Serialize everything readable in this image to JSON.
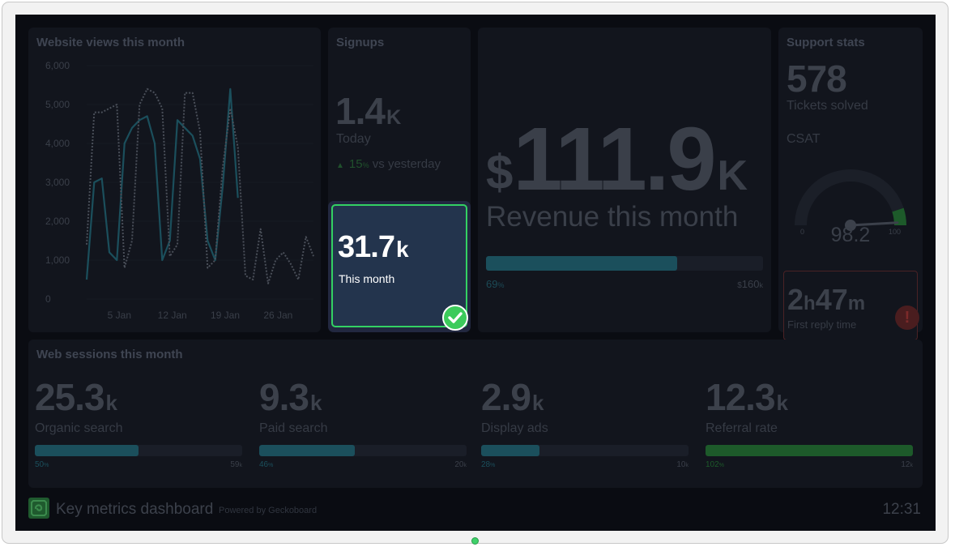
{
  "views_widget": {
    "title": "Website views this month",
    "chart_data": {
      "type": "line",
      "yticks": [
        "6,000",
        "5,000",
        "4,000",
        "3,000",
        "2,000",
        "1,000",
        "0"
      ],
      "xticks": [
        "5 Jan",
        "12 Jan",
        "19 Jan",
        "26 Jan"
      ],
      "ylim": [
        0,
        6000
      ],
      "series": [
        {
          "style": "solid",
          "color": "#1b4f5c",
          "x": [
            1,
            2,
            3,
            4,
            5,
            6,
            7,
            8,
            9,
            10,
            11,
            12,
            13,
            14,
            15,
            16,
            17,
            18,
            19,
            20,
            21
          ],
          "values": [
            500,
            3000,
            3100,
            1200,
            1000,
            4000,
            4400,
            4600,
            4700,
            4000,
            1000,
            1500,
            4600,
            4400,
            4200,
            3600,
            1500,
            1000,
            2900,
            5400,
            2600
          ]
        },
        {
          "style": "dotted",
          "color": "#4a4f59",
          "x": [
            1,
            2,
            3,
            4,
            5,
            6,
            7,
            8,
            9,
            10,
            11,
            12,
            13,
            14,
            15,
            16,
            17,
            18,
            19,
            20,
            21,
            22,
            23,
            24,
            25,
            26,
            27,
            28,
            29,
            30,
            31
          ],
          "values": [
            1400,
            4800,
            4800,
            4900,
            5000,
            800,
            1500,
            5000,
            5400,
            5300,
            4900,
            1100,
            1400,
            5300,
            5300,
            4300,
            800,
            1000,
            3400,
            4900,
            3900,
            600,
            500,
            1800,
            400,
            1000,
            1200,
            900,
            500,
            1600,
            1100
          ]
        }
      ]
    }
  },
  "signups_widget": {
    "title": "Signups",
    "today_value": "1.4",
    "today_unit": "K",
    "today_label": "Today",
    "change_value": "15",
    "change_unit": "%",
    "change_label": "vs yesterday",
    "month_value": "31.7",
    "month_unit": "k",
    "month_label": "This month",
    "accent_color": "#33d163"
  },
  "revenue_widget": {
    "currency": "$",
    "value": "111.9",
    "unit": "K",
    "label": "Revenue this month",
    "progress_pct": 69,
    "progress_label": "69",
    "progress_unit": "%",
    "target_prefix": "$",
    "target": "160",
    "target_unit": "k"
  },
  "support_widget": {
    "title": "Support stats",
    "tickets_value": "578",
    "tickets_label": "Tickets solved",
    "csat_label": "CSAT",
    "gauge_min": "0",
    "gauge_max": "100",
    "gauge_value": "98.2",
    "gauge_fraction": 0.982,
    "reply_hours": "2",
    "reply_hours_unit": "h",
    "reply_minutes": "47",
    "reply_minutes_unit": "m",
    "reply_label": "First reply time",
    "alert_icon": "alert-icon",
    "alert_color": "#c0392b"
  },
  "sessions_widget": {
    "title": "Web sessions this month",
    "items": [
      {
        "value": "25.3",
        "unit": "k",
        "label": "Organic search",
        "pct": 50,
        "pct_label": "50",
        "target": "59",
        "target_unit": "k",
        "color": "#1b4f5c"
      },
      {
        "value": "9.3",
        "unit": "k",
        "label": "Paid search",
        "pct": 46,
        "pct_label": "46",
        "target": "20",
        "target_unit": "k",
        "color": "#1b4f5c"
      },
      {
        "value": "2.9",
        "unit": "k",
        "label": "Display ads",
        "pct": 28,
        "pct_label": "28",
        "target": "10",
        "target_unit": "k",
        "color": "#1b4f5c"
      },
      {
        "value": "12.3",
        "unit": "k",
        "label": "Referral rate",
        "pct": 102,
        "pct_label": "102",
        "target": "12",
        "target_unit": "k",
        "color": "#1d5a2a"
      }
    ],
    "pct_unit": "%"
  },
  "footer": {
    "logo_icon": "geckoboard-logo-icon",
    "title": "Key metrics dashboard",
    "powered_by": "Powered by Geckoboard",
    "time": "12:31"
  }
}
